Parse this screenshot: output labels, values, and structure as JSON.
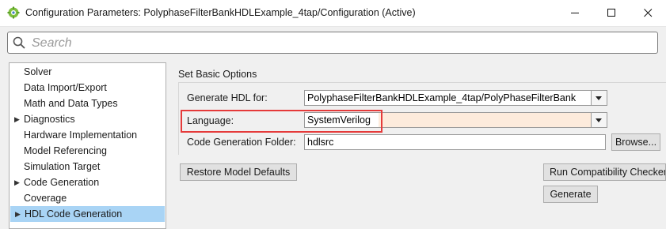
{
  "window": {
    "title": "Configuration Parameters: PolyphaseFilterBankHDLExample_4tap/Configuration (Active)",
    "app_icon": "matlab-simulink-icon"
  },
  "search": {
    "placeholder": "Search"
  },
  "tree": {
    "items": [
      {
        "label": "Solver",
        "expandable": false,
        "selected": false
      },
      {
        "label": "Data Import/Export",
        "expandable": false,
        "selected": false
      },
      {
        "label": "Math and Data Types",
        "expandable": false,
        "selected": false
      },
      {
        "label": "Diagnostics",
        "expandable": true,
        "selected": false
      },
      {
        "label": "Hardware Implementation",
        "expandable": false,
        "selected": false
      },
      {
        "label": "Model Referencing",
        "expandable": false,
        "selected": false
      },
      {
        "label": "Simulation Target",
        "expandable": false,
        "selected": false
      },
      {
        "label": "Code Generation",
        "expandable": true,
        "selected": false
      },
      {
        "label": "Coverage",
        "expandable": false,
        "selected": false
      },
      {
        "label": "HDL Code Generation",
        "expandable": true,
        "selected": true
      }
    ]
  },
  "panel": {
    "group_title": "Set Basic Options",
    "generate_hdl_for": {
      "label": "Generate HDL for:",
      "value": "PolyphaseFilterBankHDLExample_4tap/PolyPhaseFilterBank"
    },
    "language": {
      "label": "Language:",
      "value": "SystemVerilog"
    },
    "folder": {
      "label": "Code Generation Folder:",
      "value": "hdlsrc",
      "browse_label": "Browse..."
    },
    "restore_label": "Restore Model Defaults",
    "compat_label": "Run Compatibility Checker",
    "generate_label": "Generate"
  },
  "colors": {
    "highlight": "#e53a3a",
    "selection": "#a9d4f5",
    "modified_field": "#fdebdc"
  }
}
